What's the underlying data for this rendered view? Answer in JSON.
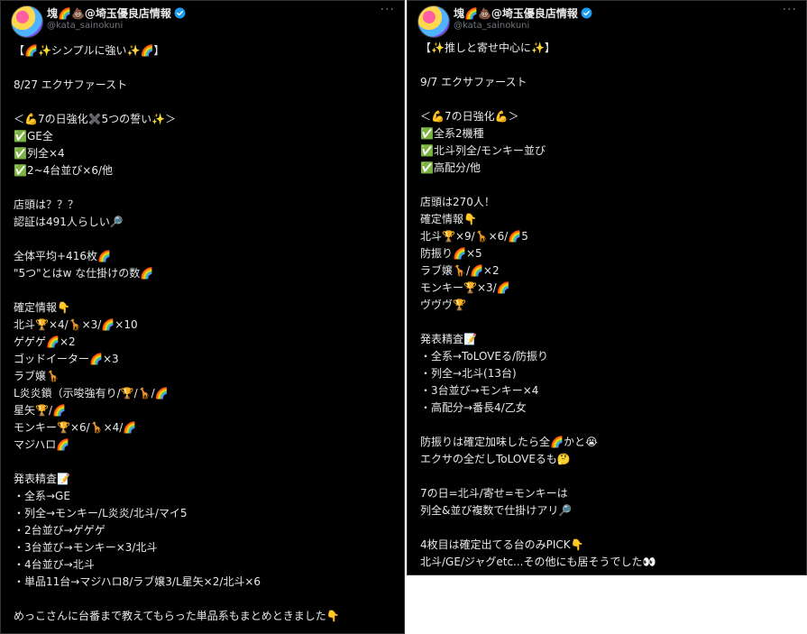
{
  "posts": [
    {
      "author": {
        "display_name": "塊🌈💩@埼玉優良店情報",
        "handle": "@kata_sainokuni",
        "avatar_icon": "avatar-rainbow"
      },
      "more_label": "···",
      "lines": [
        "【🌈✨シンプルに強い✨🌈】",
        "",
        "8/27 エクサファースト",
        "",
        "＜💪7の日強化✖️5つの誓い✨＞",
        "✅GE全",
        "✅列全×4",
        "✅2~4台並び×6/他",
        "",
        "店頭は？？？",
        "認証は491人らしい🔎",
        "",
        "全体平均+416枚🌈",
        "\"5つ\"とはw な仕掛けの数🌈",
        "",
        "確定情報👇",
        "北斗🏆×4/🦒×3/🌈×10",
        "ゲゲゲ🌈×2",
        "ゴッドイーター🌈×3",
        "ラブ嬢🦒",
        "L炎炎鎖（示唆強有り/🏆/🦒/🌈",
        "星矢🏆/🌈",
        "モンキー🏆×6/🦒×4/🌈",
        "マジハロ🌈",
        "",
        "発表精査📝",
        "・全系→GE",
        "・列全→モンキー/L炎炎/北斗/マイ5",
        "・2台並び→ゲゲゲ",
        "・3台並び→モンキー×3/北斗",
        "・4台並び→北斗",
        "・単品11台→マジハロ8/ラブ嬢3/L星矢×2/北斗×6",
        "",
        "めっこさんに台番まで教えてもらった単品系もまとめときました👇"
      ]
    },
    {
      "author": {
        "display_name": "塊🌈💩@埼玉優良店情報",
        "handle": "@kata_sainokuni",
        "avatar_icon": "avatar-rainbow"
      },
      "more_label": "···",
      "lines": [
        "【✨推しと寄せ中心に✨】",
        "",
        "9/7 エクサファースト",
        "",
        "＜💪7の日強化💪＞",
        "✅全系2機種",
        "✅北斗列全/モンキー並び",
        "✅高配分/他",
        "",
        "店頭は270人！",
        "確定情報👇",
        "北斗🏆×9/🦒×6/🌈5",
        "防振り🌈×5",
        "ラブ嬢🦒/🌈×2",
        "モンキー🏆×3/🌈",
        "ヴヴヴ🏆",
        "",
        "発表精査📝",
        "・全系→ToLOVEる/防振り",
        "・列全→北斗(13台)",
        "・3台並び→モンキー×4",
        "・高配分→番長4/乙女",
        "",
        "防振りは確定加味したら全🌈かと😭",
        "エクサの全だしToLOVEるも🤔",
        "",
        "7の日=北斗/寄せ=モンキーは",
        "列全&並び複数で仕掛けアリ🔎",
        "",
        "4枚目は確定出てる台のみPICK👇",
        "北斗/GE/ジャグetc...その他にも居そうでした👀"
      ]
    }
  ],
  "colors": {
    "background": "#000000",
    "text": "#e7e9ea",
    "muted": "#71767b",
    "verified": "#1d9bf0"
  }
}
